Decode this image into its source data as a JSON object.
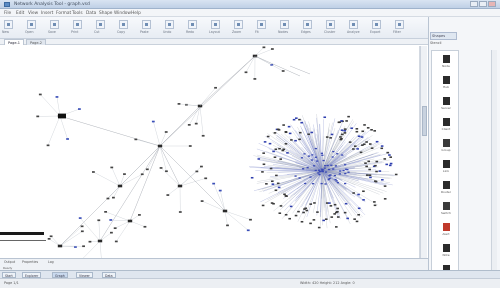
{
  "window": {
    "title": "Network Analysis Tool - graph.vsd"
  },
  "menu": [
    "File",
    "Edit",
    "View",
    "Insert",
    "Format",
    "Tools",
    "Data",
    "Shape",
    "Window",
    "Help"
  ],
  "toolbar": {
    "buttons": [
      "New",
      "Open",
      "Save",
      "Print",
      "Cut",
      "Copy",
      "Paste",
      "Undo",
      "Redo",
      "Layout",
      "Zoom",
      "Fit",
      "Nodes",
      "Edges",
      "Cluster",
      "Analyze",
      "Export",
      "Filter"
    ]
  },
  "tabs": [
    "Page-1",
    "Page-2"
  ],
  "right_panel": {
    "header": "Shapes",
    "subheader": "Stencil",
    "items": [
      "Node",
      "Hub",
      "Server",
      "Client",
      "Group",
      "Link",
      "Router",
      "Switch",
      "Alert",
      "Note",
      "User"
    ]
  },
  "bottom_panel": {
    "tabs": [
      "Output",
      "Properties",
      "Log"
    ],
    "row": "Ready"
  },
  "taskbar": {
    "items": [
      "Start",
      "Explorer",
      "Graph",
      "Viewer",
      "Data"
    ]
  },
  "status": {
    "left": "Page 1/1",
    "right": "Width: 420  Height: 212  Angle: 0"
  }
}
